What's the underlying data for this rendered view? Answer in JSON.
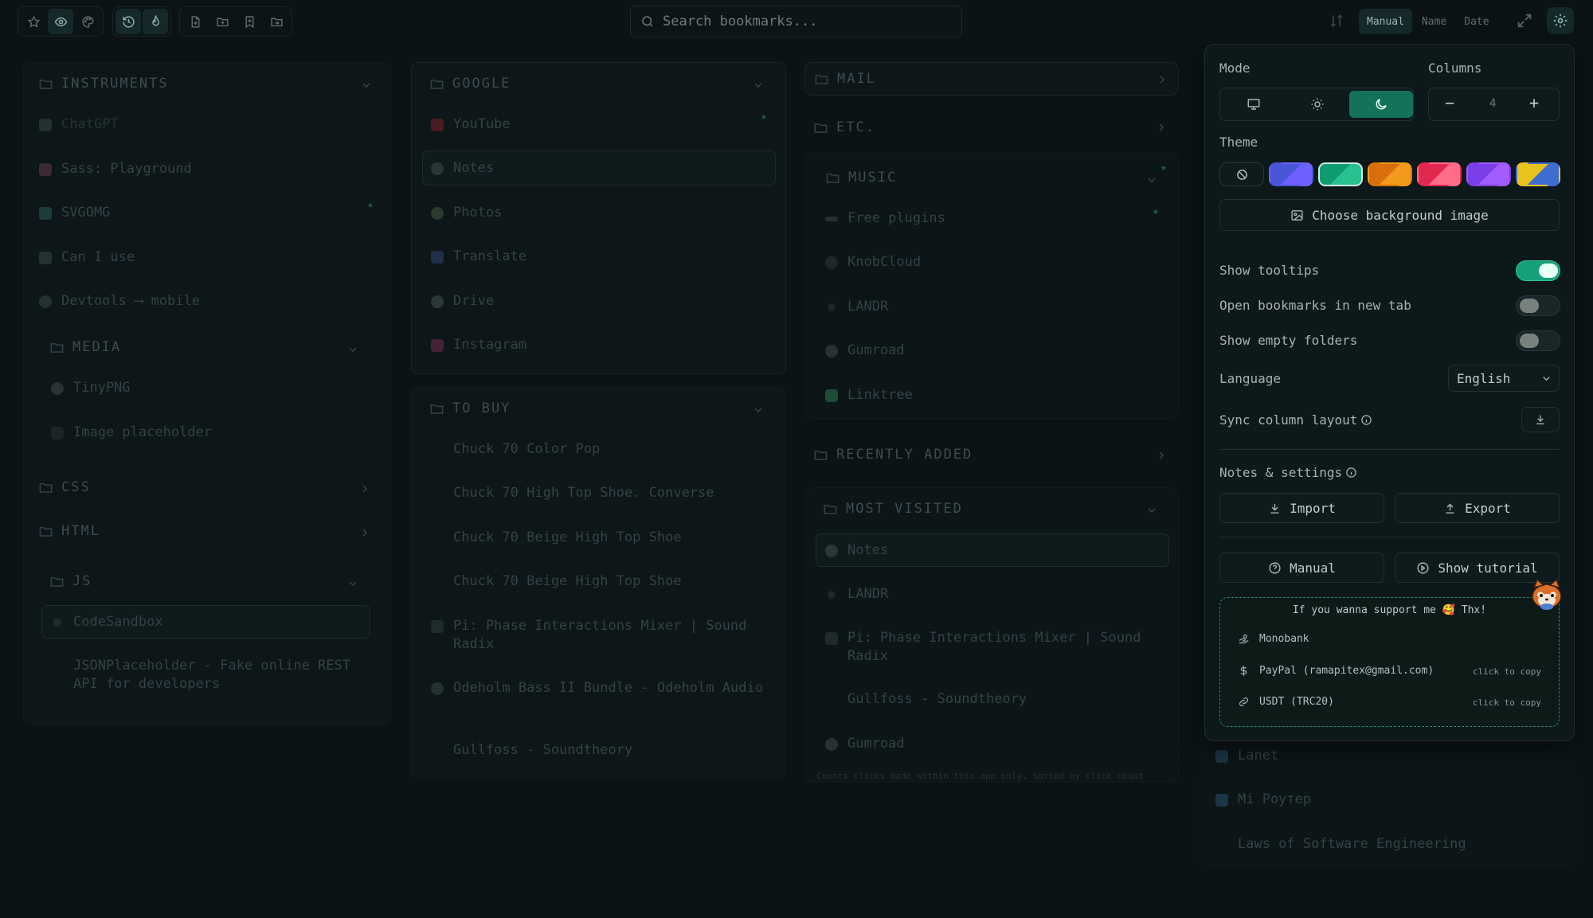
{
  "toolbar": {
    "left_icons": [
      "star-icon",
      "eye-icon",
      "palette-icon"
    ],
    "mid_icons": [
      "history-icon",
      "flame-icon"
    ],
    "right_icons": [
      "new-file-icon",
      "new-folder-icon",
      "bookmark-add-icon",
      "folder-move-icon"
    ]
  },
  "search": {
    "placeholder": "Search bookmarks..."
  },
  "sort": {
    "options": [
      "Manual",
      "Name",
      "Date"
    ],
    "active": "Manual"
  },
  "columns": {
    "col1": {
      "folder1": "INSTRUMENTS",
      "items1": [
        "ChatGPT",
        "Sass: Playground",
        "SVGOMG",
        "Can I use",
        "Devtools ⟶ mobile"
      ],
      "folder2": "MEDIA",
      "items2": [
        "TinyPNG",
        "Image placeholder"
      ],
      "folder3": "CSS",
      "folder4": "HTML",
      "folder5": "JS",
      "items5": [
        "CodeSandbox",
        "JSONPlaceholder - Fake online REST API for developers"
      ]
    },
    "col2": {
      "folder1": "GOOGLE",
      "items1": [
        "YouTube",
        "Notes",
        "Photos",
        "Translate",
        "Drive",
        "Instagram"
      ],
      "folder2": "TO BUY",
      "items2": [
        "Chuck 70 Color Pop",
        "Chuck 70 High Top Shoe. Converse",
        "Chuck 70 Beige High Top Shoe",
        "Chuck 70 Beige High Top Shoe",
        "Pi: Phase Interactions Mixer | Sound Radix",
        "Odeholm Bass II Bundle - Odeholm Audio",
        "Gullfoss - Soundtheory"
      ]
    },
    "col3": {
      "folder1": "MAIL",
      "folder2": "ETC.",
      "folder3": "MUSIC",
      "items3": [
        "Free plugins",
        "KnobCloud",
        "LANDR",
        "Gumroad",
        "Linktree"
      ],
      "folder4": "RECENTLY ADDED",
      "folder5": "MOST VISITED",
      "items5": [
        "Notes",
        "LANDR",
        "Pi: Phase Interactions Mixer | Sound Radix",
        "Gullfoss - Soundtheory",
        "Gumroad"
      ],
      "hint": "Counts clicks made within this app only, sorted by click count"
    },
    "col4": {
      "items": [
        "Lanet",
        "Mi Poyтер",
        "Laws of Software Engineering"
      ]
    }
  },
  "settings": {
    "mode_label": "Mode",
    "columns_label": "Columns",
    "columns_value": "4",
    "columns_minus": "−",
    "columns_plus": "+",
    "theme_label": "Theme",
    "theme_colors": [
      [
        "#4a56d8",
        "#6d62ff"
      ],
      [
        "#109c72",
        "#28c08f"
      ],
      [
        "#d86f0a",
        "#f29a1c"
      ],
      [
        "#e3284f",
        "#ff6d8a"
      ],
      [
        "#7a3fe8",
        "#a25cff"
      ],
      [
        "#e8c21d",
        "#3f6ccf"
      ]
    ],
    "bg_button": "Choose background image",
    "toggles": [
      {
        "label": "Show tooltips",
        "on": true
      },
      {
        "label": "Open bookmarks in new tab",
        "on": false
      },
      {
        "label": "Show empty folders",
        "on": false
      }
    ],
    "language_label": "Language",
    "language_value": "English",
    "sync_label": "Sync column layout",
    "notes_label": "Notes & settings",
    "import": "Import",
    "export": "Export",
    "manual": "Manual",
    "tutorial": "Show tutorial",
    "support_title": "If you wanna support me 🥰 Thx!",
    "support": [
      {
        "name": "Monobank",
        "copy": ""
      },
      {
        "name": "PayPal (ramapitex@gmail.com)",
        "copy": "click to copy"
      },
      {
        "name": "USDT (TRC20)",
        "copy": "click to copy"
      }
    ],
    "accent": "#16a07a"
  }
}
